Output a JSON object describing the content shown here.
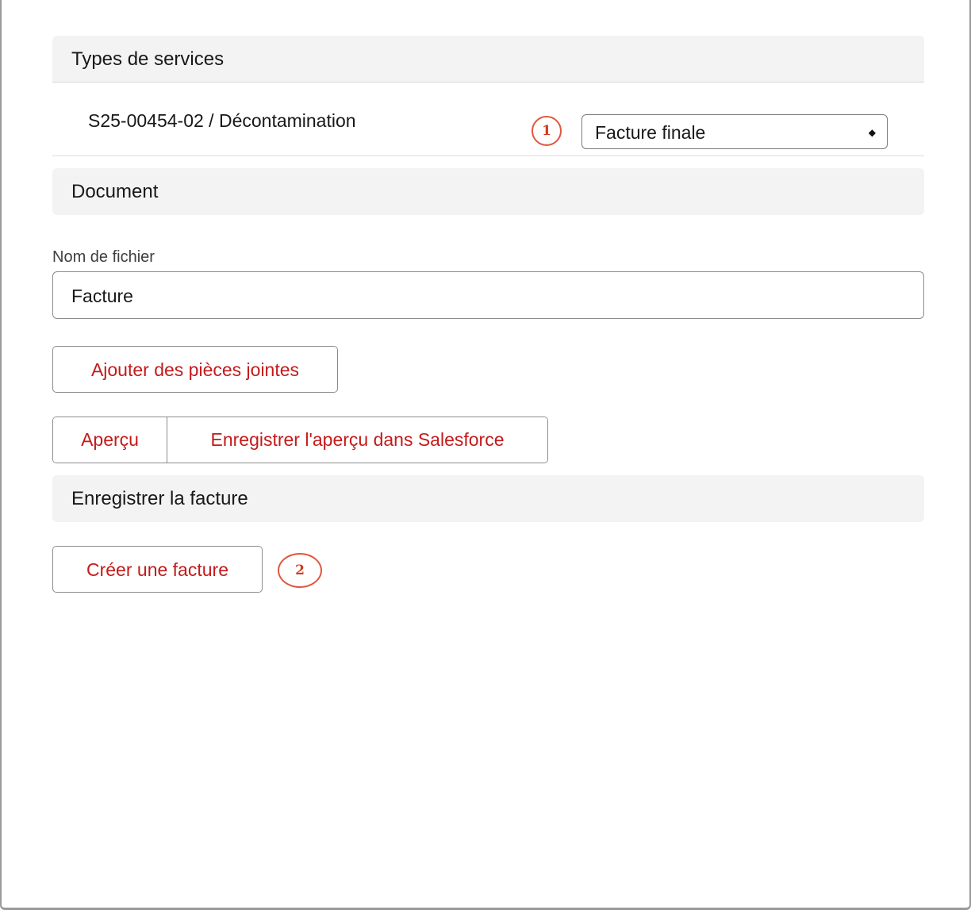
{
  "sections": {
    "services_title": "Types de services",
    "document_title": "Document",
    "save_title": "Enregistrer la facture"
  },
  "service": {
    "name": "S25-00454-02 / Décontamination",
    "invoice_type_selected": "Facture finale"
  },
  "markers": {
    "one": "1",
    "two": "2"
  },
  "document": {
    "filename_label": "Nom de fichier",
    "filename_value": "Facture",
    "attach_label": "Ajouter des pièces jointes",
    "preview_label": "Aperçu",
    "save_preview_label": "Enregistrer l'aperçu dans Salesforce"
  },
  "actions": {
    "create_invoice_label": "Créer une facture"
  },
  "colors": {
    "accent": "#c41a1a",
    "marker": "#e0573e",
    "header_bg": "#f3f3f3"
  }
}
